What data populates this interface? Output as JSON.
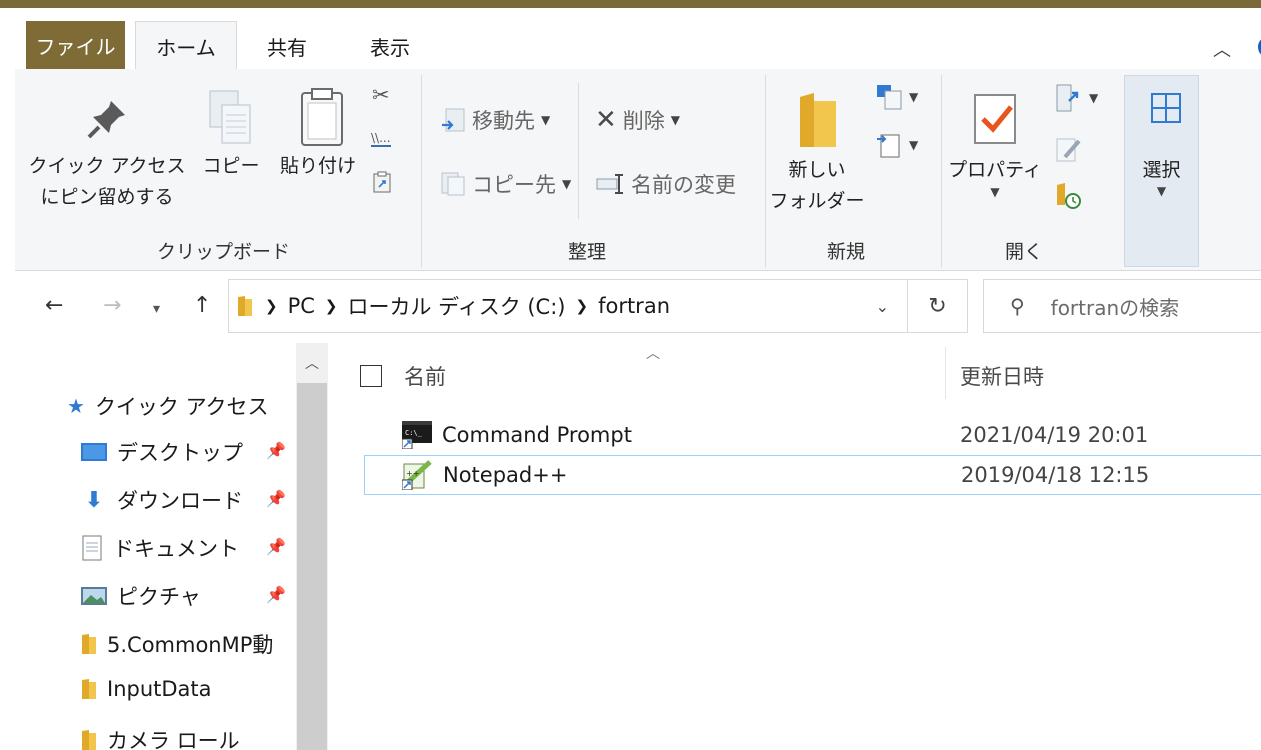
{
  "ribbon_tabs": {
    "file": "ファイル",
    "home": "ホーム",
    "share": "共有",
    "view": "表示"
  },
  "clipboard": {
    "pin_line1": "クイック アクセス",
    "pin_line2": "にピン留めする",
    "copy": "コピー",
    "paste": "貼り付け",
    "label": "クリップボード"
  },
  "organize": {
    "move_to": "移動先",
    "copy_to": "コピー先",
    "delete": "削除",
    "rename": "名前の変更",
    "label": "整理"
  },
  "new": {
    "new_folder_line1": "新しい",
    "new_folder_line2": "フォルダー",
    "label": "新規"
  },
  "open": {
    "properties": "プロパティ",
    "label": "開く"
  },
  "select": {
    "label": "選択"
  },
  "address": {
    "crumbs": [
      "PC",
      "ローカル ディスク (C:)",
      "fortran"
    ],
    "search_placeholder": "fortranの検索"
  },
  "navpane": {
    "quick_access": "クイック アクセス",
    "items": [
      {
        "label": "デスクトップ",
        "pinned": true
      },
      {
        "label": "ダウンロード",
        "pinned": true
      },
      {
        "label": "ドキュメント",
        "pinned": true
      },
      {
        "label": "ピクチャ",
        "pinned": true
      },
      {
        "label": "5.CommonMP動",
        "pinned": false
      },
      {
        "label": "InputData",
        "pinned": false
      },
      {
        "label": "カメラ ロール",
        "pinned": false
      }
    ]
  },
  "filelist": {
    "col_name": "名前",
    "col_modified": "更新日時",
    "rows": [
      {
        "name": "Command Prompt",
        "modified": "2021/04/19 20:01"
      },
      {
        "name": "Notepad++",
        "modified": "2019/04/18 12:15"
      }
    ]
  },
  "colors": {
    "file_tab": "#7e6b36",
    "accent": "#2f7bd1",
    "selection_border": "#99d1ff"
  }
}
